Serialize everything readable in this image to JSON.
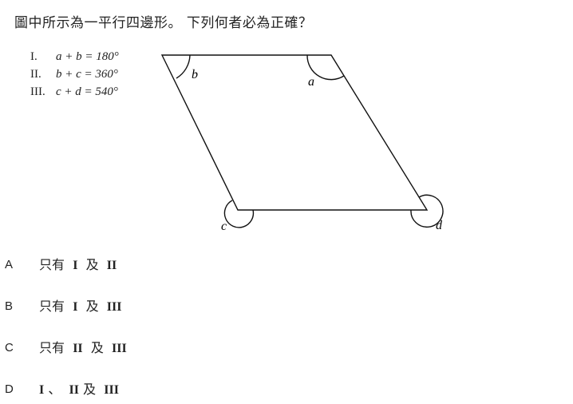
{
  "question": "圖中所示為一平行四邊形。 下列何者必為正確？",
  "statements": [
    {
      "num": "I.",
      "expr": "a + b = 180°"
    },
    {
      "num": "II.",
      "expr": "b + c = 360°"
    },
    {
      "num": "III.",
      "expr": "c + d = 540°"
    }
  ],
  "figure": {
    "angle_labels": {
      "a": "a",
      "b": "b",
      "c": "c",
      "d": "d"
    }
  },
  "options": [
    {
      "letter": "A",
      "prefix": "只有",
      "items": [
        "I",
        "II"
      ],
      "joiner": "及"
    },
    {
      "letter": "B",
      "prefix": "只有",
      "items": [
        "I",
        "III"
      ],
      "joiner": "及"
    },
    {
      "letter": "C",
      "prefix": "只有",
      "items": [
        "II",
        "III"
      ],
      "joiner": "及"
    },
    {
      "letter": "D",
      "first": "I",
      "sep": "、",
      "second": "II",
      "joiner": "及",
      "third": "III"
    }
  ]
}
